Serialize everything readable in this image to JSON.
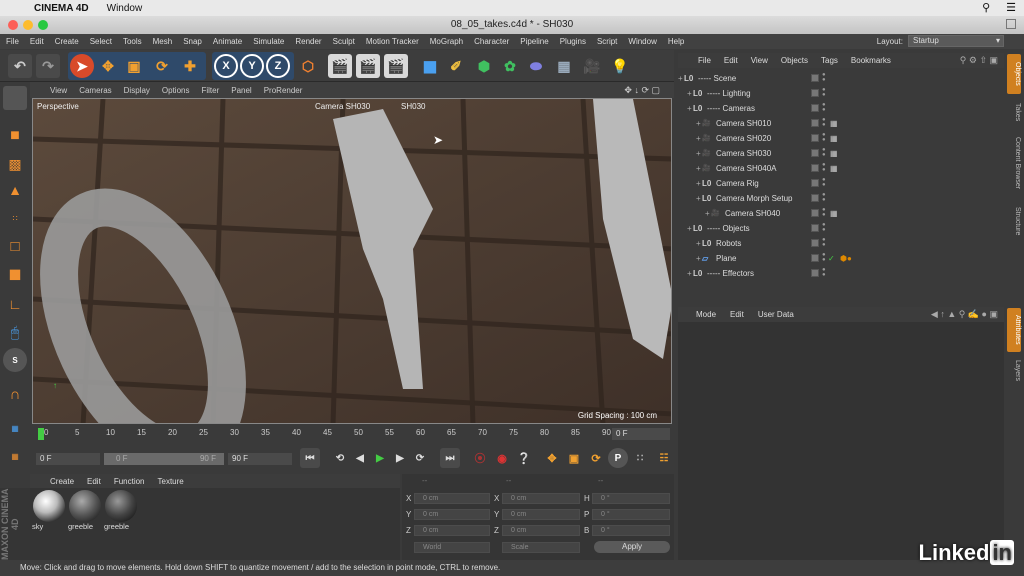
{
  "mac": {
    "app_name": "CINEMA 4D",
    "menu_window": "Window"
  },
  "window": {
    "title": "08_05_takes.c4d * - SH030"
  },
  "menu": [
    "File",
    "Edit",
    "Create",
    "Select",
    "Tools",
    "Mesh",
    "Snap",
    "Animate",
    "Simulate",
    "Render",
    "Sculpt",
    "Motion Tracker",
    "MoGraph",
    "Character",
    "Pipeline",
    "Plugins",
    "Script",
    "Window",
    "Help"
  ],
  "layout": {
    "label": "Layout:",
    "value": "Startup"
  },
  "toolbar": {
    "x_label": "X",
    "y_label": "Y",
    "z_label": "Z"
  },
  "viewport": {
    "menu": [
      "View",
      "Cameras",
      "Display",
      "Options",
      "Filter",
      "Panel",
      "ProRender"
    ],
    "name": "Perspective",
    "camera_label": "Camera SH030",
    "take_label": "SH030",
    "grid_spacing": "Grid Spacing : 100 cm"
  },
  "timeline": {
    "ticks": [
      "0",
      "5",
      "10",
      "15",
      "20",
      "25",
      "30",
      "35",
      "40",
      "45",
      "50",
      "55",
      "60",
      "65",
      "70",
      "75",
      "80",
      "85",
      "90"
    ],
    "current_frame": "0 F"
  },
  "transport": {
    "start": "0 F",
    "preview_start": "0 F",
    "preview_end": "90 F",
    "end": "90 F"
  },
  "object_manager": {
    "menu": [
      "File",
      "Edit",
      "View",
      "Objects",
      "Tags",
      "Bookmarks"
    ],
    "rows": [
      {
        "name": "----- Scene",
        "level": 0,
        "type": "null"
      },
      {
        "name": "----- Lighting",
        "level": 1,
        "type": "null"
      },
      {
        "name": "----- Cameras",
        "level": 1,
        "type": "null"
      },
      {
        "name": "Camera SH010",
        "level": 2,
        "type": "camera"
      },
      {
        "name": "Camera SH020",
        "level": 2,
        "type": "camera"
      },
      {
        "name": "Camera SH030",
        "level": 2,
        "type": "camera"
      },
      {
        "name": "Camera SH040A",
        "level": 2,
        "type": "camera"
      },
      {
        "name": "Camera Rig",
        "level": 2,
        "type": "null"
      },
      {
        "name": "Camera Morph Setup",
        "level": 2,
        "type": "null"
      },
      {
        "name": "Camera SH040",
        "level": 3,
        "type": "camera"
      },
      {
        "name": "----- Objects",
        "level": 1,
        "type": "null"
      },
      {
        "name": "Robots",
        "level": 2,
        "type": "null"
      },
      {
        "name": "Plane",
        "level": 2,
        "type": "plane"
      },
      {
        "name": "----- Effectors",
        "level": 1,
        "type": "null"
      }
    ]
  },
  "attributes": {
    "menu": [
      "Mode",
      "Edit",
      "User Data"
    ]
  },
  "right_tabs": [
    "Objects",
    "Takes",
    "Content Browser",
    "Structure",
    "Attributes",
    "Layers"
  ],
  "materials": {
    "menu": [
      "Create",
      "Edit",
      "Function",
      "Texture"
    ],
    "items": [
      "sky",
      "greeble",
      "greeble"
    ]
  },
  "coords": {
    "header": [
      "--",
      "--",
      "--"
    ],
    "labels_pos": [
      "X",
      "Y",
      "Z"
    ],
    "labels_size": [
      "X",
      "Y",
      "Z"
    ],
    "labels_rot": [
      "H",
      "P",
      "B"
    ],
    "pos": [
      "0 cm",
      "0 cm",
      "0 cm"
    ],
    "size": [
      "0 cm",
      "0 cm",
      "0 cm"
    ],
    "rot": [
      "0 °",
      "0 °",
      "0 °"
    ],
    "mode": "World",
    "scale": "Scale",
    "apply": "Apply"
  },
  "status": "Move: Click and drag to move elements. Hold down SHIFT to quantize movement / add to the selection in point mode, CTRL to remove.",
  "brand": {
    "maxon": "MAXON CINEMA 4D",
    "linkedin": "Linked",
    "linkedin_in": "in"
  }
}
